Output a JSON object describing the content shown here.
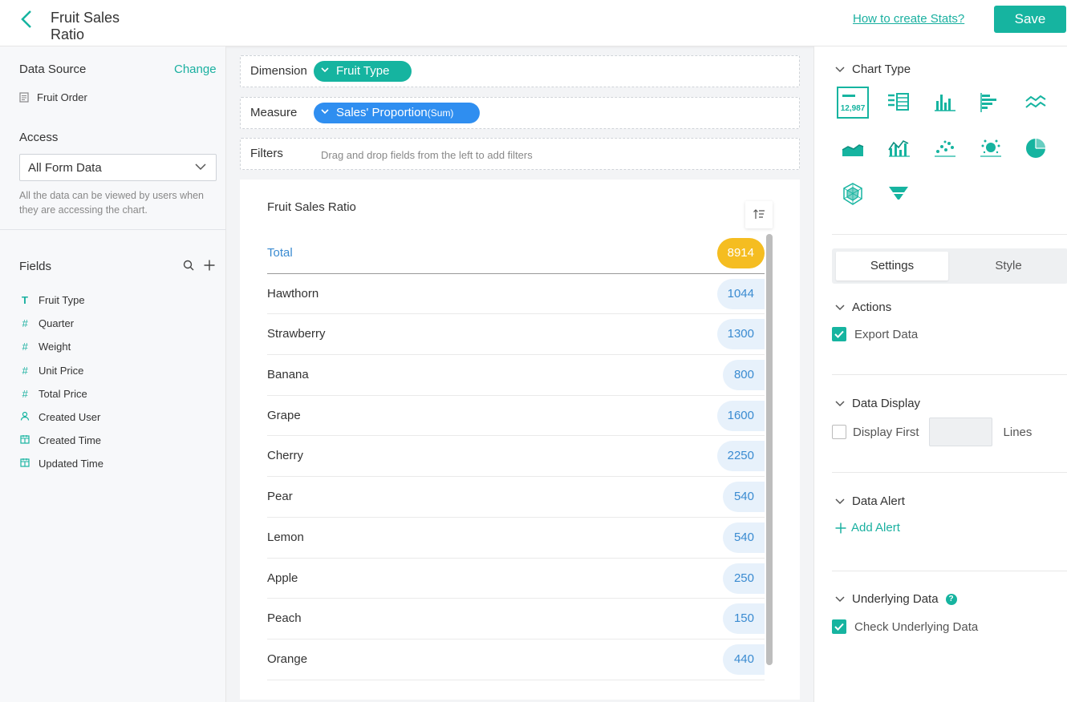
{
  "header": {
    "title": "Fruit Sales Ratio",
    "help_link": "How to create Stats?",
    "save_label": "Save"
  },
  "left": {
    "data_source_label": "Data Source",
    "change_label": "Change",
    "data_source_item": "Fruit Order",
    "access_label": "Access",
    "access_value": "All Form Data",
    "access_desc": "All the data can be viewed by users when they are accessing the chart.",
    "fields_label": "Fields",
    "fields": [
      {
        "label": "Fruit Type",
        "icon": "text-field-icon"
      },
      {
        "label": "Quarter",
        "icon": "number-field-icon"
      },
      {
        "label": "Weight",
        "icon": "number-field-icon"
      },
      {
        "label": "Unit Price",
        "icon": "number-field-icon"
      },
      {
        "label": "Total Price",
        "icon": "number-field-icon"
      },
      {
        "label": "Created User",
        "icon": "user-field-icon"
      },
      {
        "label": "Created Time",
        "icon": "calendar-field-icon"
      },
      {
        "label": "Updated Time",
        "icon": "calendar-field-icon"
      }
    ]
  },
  "config": {
    "dimension_label": "Dimension",
    "dimension_value": "Fruit Type",
    "measure_label": "Measure",
    "measure_value": "Sales' Proportion",
    "measure_agg": "(Sum)",
    "filters_label": "Filters",
    "filters_hint": "Drag and drop fields from the left to add filters"
  },
  "chart_data": {
    "type": "table",
    "title": "Fruit Sales Ratio",
    "total_label": "Total",
    "total_value": "8914",
    "rows": [
      {
        "label": "Hawthorn",
        "value": "1044"
      },
      {
        "label": "Strawberry",
        "value": "1300"
      },
      {
        "label": "Banana",
        "value": "800"
      },
      {
        "label": "Grape",
        "value": "1600"
      },
      {
        "label": "Cherry",
        "value": "2250"
      },
      {
        "label": "Pear",
        "value": "540"
      },
      {
        "label": "Lemon",
        "value": "540"
      },
      {
        "label": "Apple",
        "value": "250"
      },
      {
        "label": "Peach",
        "value": "150"
      },
      {
        "label": "Orange",
        "value": "440"
      }
    ]
  },
  "right": {
    "chart_type_label": "Chart Type",
    "kpi_icon_text": "12,987",
    "tabs": {
      "settings": "Settings",
      "style": "Style"
    },
    "actions_label": "Actions",
    "export_data_label": "Export Data",
    "data_display_label": "Data Display",
    "display_first_label": "Display First",
    "lines_label": "Lines",
    "data_alert_label": "Data Alert",
    "add_alert_label": "Add Alert",
    "underlying_label": "Underlying Data",
    "check_underlying_label": "Check Underlying Data",
    "help_mark": "?"
  },
  "colors": {
    "accent": "#16b4a0",
    "link_blue": "#3a8bd1",
    "measure_pill": "#2f8ef0",
    "total_badge": "#f5bd21"
  }
}
